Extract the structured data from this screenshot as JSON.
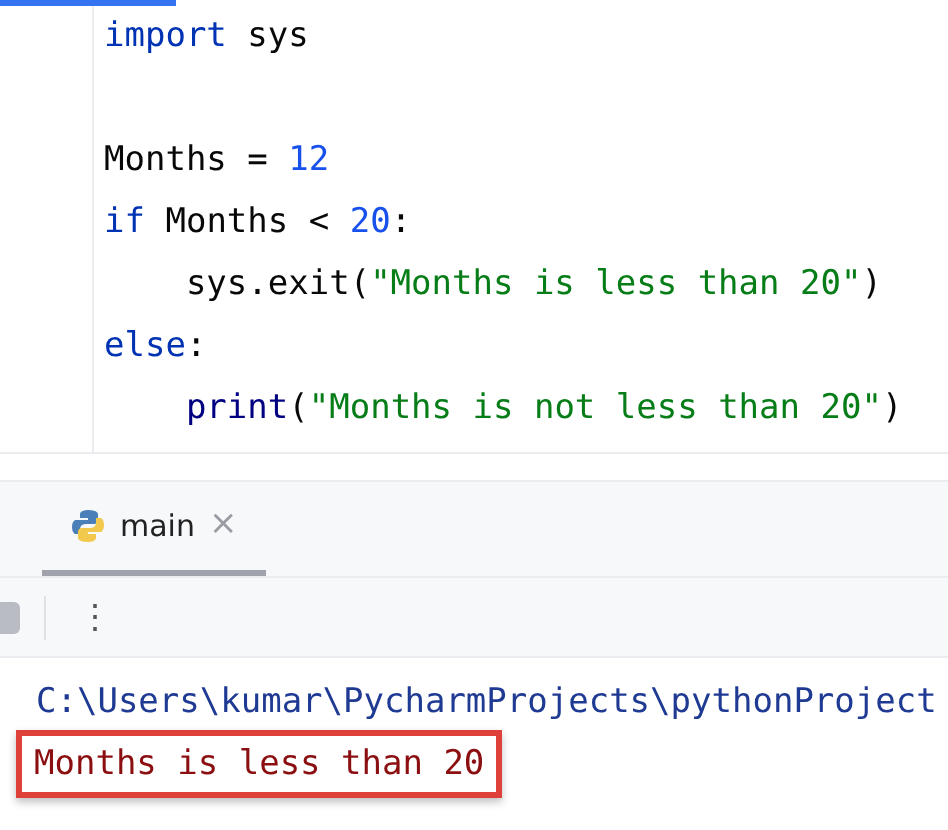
{
  "editor": {
    "lines": [
      {
        "kind": "code",
        "tokens": [
          {
            "kind": "keyword",
            "text": "import"
          },
          {
            "kind": "plain",
            "text": " sys"
          }
        ]
      },
      {
        "kind": "blank"
      },
      {
        "kind": "code",
        "tokens": [
          {
            "kind": "plain",
            "text": "Months = "
          },
          {
            "kind": "number",
            "text": "12"
          }
        ]
      },
      {
        "kind": "code",
        "tokens": [
          {
            "kind": "keyword",
            "text": "if"
          },
          {
            "kind": "plain",
            "text": " Months < "
          },
          {
            "kind": "number",
            "text": "20"
          },
          {
            "kind": "plain",
            "text": ":"
          }
        ]
      },
      {
        "kind": "code",
        "indent": true,
        "tokens": [
          {
            "kind": "plain",
            "text": "sys.exit("
          },
          {
            "kind": "string",
            "text": "\"Months is less than 20\""
          },
          {
            "kind": "plain",
            "text": ")"
          }
        ]
      },
      {
        "kind": "code",
        "tokens": [
          {
            "kind": "keyword",
            "text": "else"
          },
          {
            "kind": "plain",
            "text": ":"
          }
        ]
      },
      {
        "kind": "code",
        "indent": true,
        "tokens": [
          {
            "kind": "builtin",
            "text": "print"
          },
          {
            "kind": "plain",
            "text": "("
          },
          {
            "kind": "string",
            "text": "\"Months is not less than 20\""
          },
          {
            "kind": "plain",
            "text": ")"
          }
        ]
      }
    ]
  },
  "run_panel": {
    "tabs": [
      {
        "label": "main",
        "close": "×",
        "selected": true
      }
    ],
    "menu": "⋮",
    "output": [
      {
        "kind": "path",
        "text": "C:\\Users\\kumar\\PycharmProjects\\pythonProject",
        "highlighted": false
      },
      {
        "kind": "error",
        "text": "Months is less than 20",
        "highlighted": true
      }
    ]
  }
}
